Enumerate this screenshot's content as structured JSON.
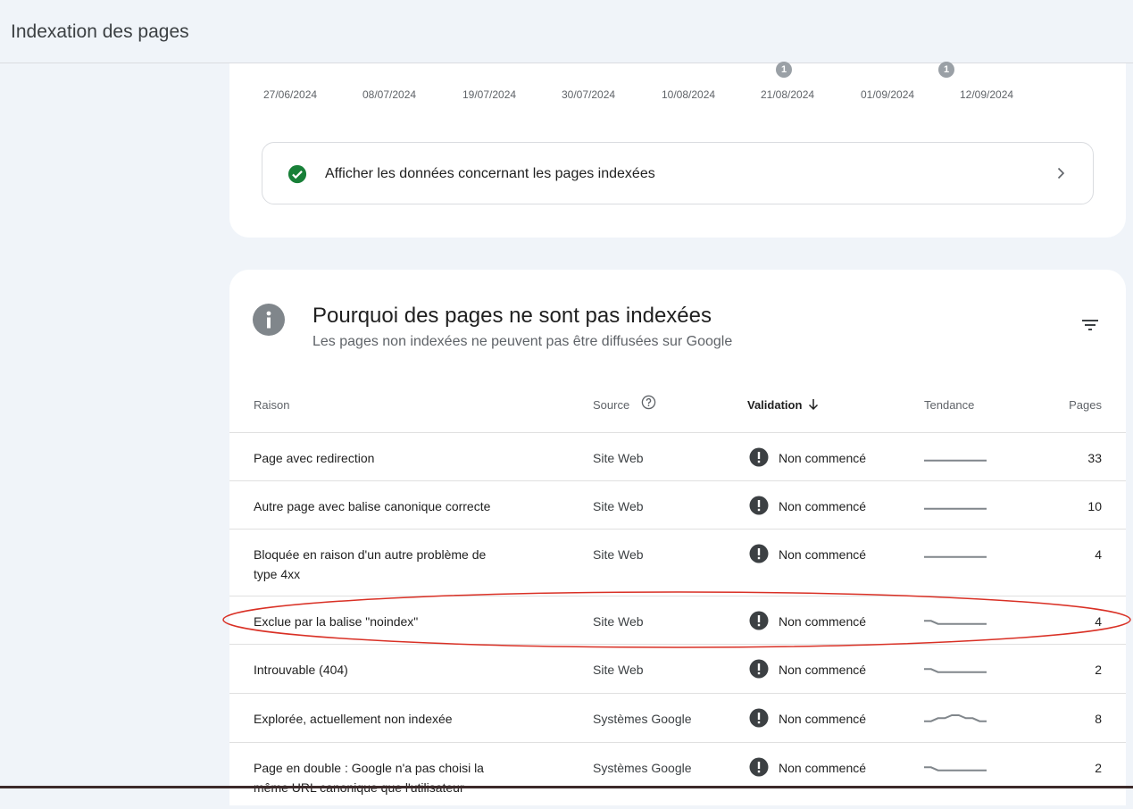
{
  "header": {
    "title": "Indexation des pages"
  },
  "timeline": {
    "dates": [
      "27/06/2024",
      "08/07/2024",
      "19/07/2024",
      "30/07/2024",
      "10/08/2024",
      "21/08/2024",
      "01/09/2024",
      "12/09/2024"
    ],
    "markers": [
      {
        "label": "1",
        "date": "21/08/2024"
      },
      {
        "label": "1",
        "date": "12/09/2024"
      }
    ]
  },
  "indexed_link": {
    "label": "Afficher les données concernant les pages indexées"
  },
  "not_indexed": {
    "title": "Pourquoi des pages ne sont pas indexées",
    "subtitle": "Les pages non indexées ne peuvent pas être diffusées sur Google",
    "columns": {
      "reason": "Raison",
      "source": "Source",
      "validation": "Validation",
      "trend": "Tendance",
      "pages": "Pages"
    },
    "rows": [
      {
        "reason": "Page avec redirection",
        "source": "Site Web",
        "status": "Non commencé",
        "pages": "33",
        "trend": [
          1,
          1,
          1,
          1,
          1,
          1,
          1,
          1,
          1,
          1
        ]
      },
      {
        "reason": "Autre page avec balise canonique correcte",
        "source": "Site Web",
        "status": "Non commencé",
        "pages": "10",
        "trend": [
          1,
          1,
          1,
          1,
          1,
          1,
          1,
          1,
          1,
          1
        ]
      },
      {
        "reason": "Bloquée en raison d'un autre problème de type 4xx",
        "source": "Site Web",
        "status": "Non commencé",
        "pages": "4",
        "trend": [
          1,
          1,
          1,
          1,
          1,
          1,
          1,
          1,
          1,
          1
        ]
      },
      {
        "reason": "Exclue par la balise \"noindex\"",
        "source": "Site Web",
        "status": "Non commencé",
        "pages": "4",
        "trend": [
          2,
          2,
          1,
          1,
          1,
          1,
          1,
          1,
          1,
          1
        ]
      },
      {
        "reason": "Introuvable (404)",
        "source": "Site Web",
        "status": "Non commencé",
        "pages": "2",
        "trend": [
          2,
          2,
          1,
          1,
          1,
          1,
          1,
          1,
          1,
          1
        ]
      },
      {
        "reason": "Explorée, actuellement non indexée",
        "source": "Systèmes Google",
        "status": "Non commencé",
        "pages": "8",
        "trend": [
          1,
          1,
          2,
          2,
          3,
          3,
          2,
          2,
          1,
          1
        ]
      },
      {
        "reason": "Page en double : Google n'a pas choisi la même URL canonique que l'utilisateur",
        "source": "Systèmes Google",
        "status": "Non commencé",
        "pages": "2",
        "trend": [
          2,
          2,
          1,
          1,
          1,
          1,
          1,
          1,
          1,
          1
        ]
      }
    ]
  },
  "colors": {
    "success": "#188038",
    "warning": "#3c4043",
    "highlight": "#d93025",
    "background": "#f0f4f9"
  }
}
